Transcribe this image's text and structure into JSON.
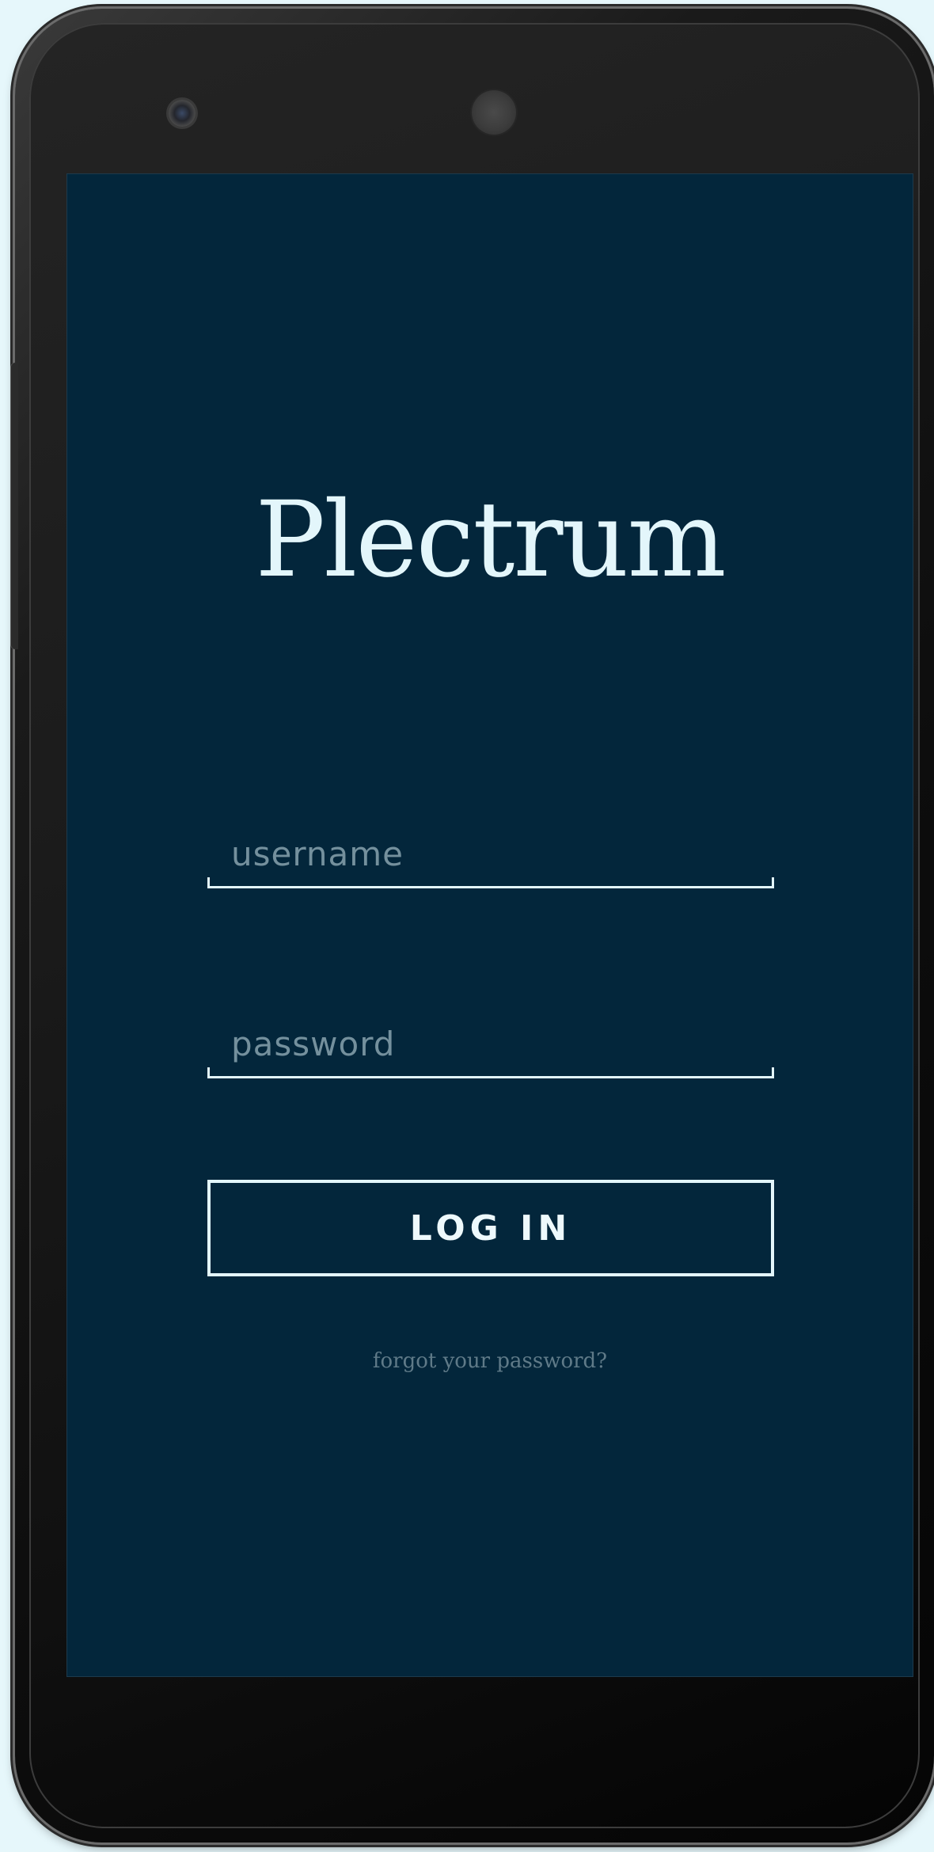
{
  "app": {
    "logo_text": "Plectrum"
  },
  "login_form": {
    "username_placeholder": "username",
    "password_placeholder": "password",
    "login_button_label": "LOG IN",
    "forgot_password_label": "forgot your password?"
  },
  "colors": {
    "screen_background": "#03263b",
    "foreground": "#e3f6fb",
    "muted_text": "#74909d",
    "page_background": "#e6f7fb"
  }
}
